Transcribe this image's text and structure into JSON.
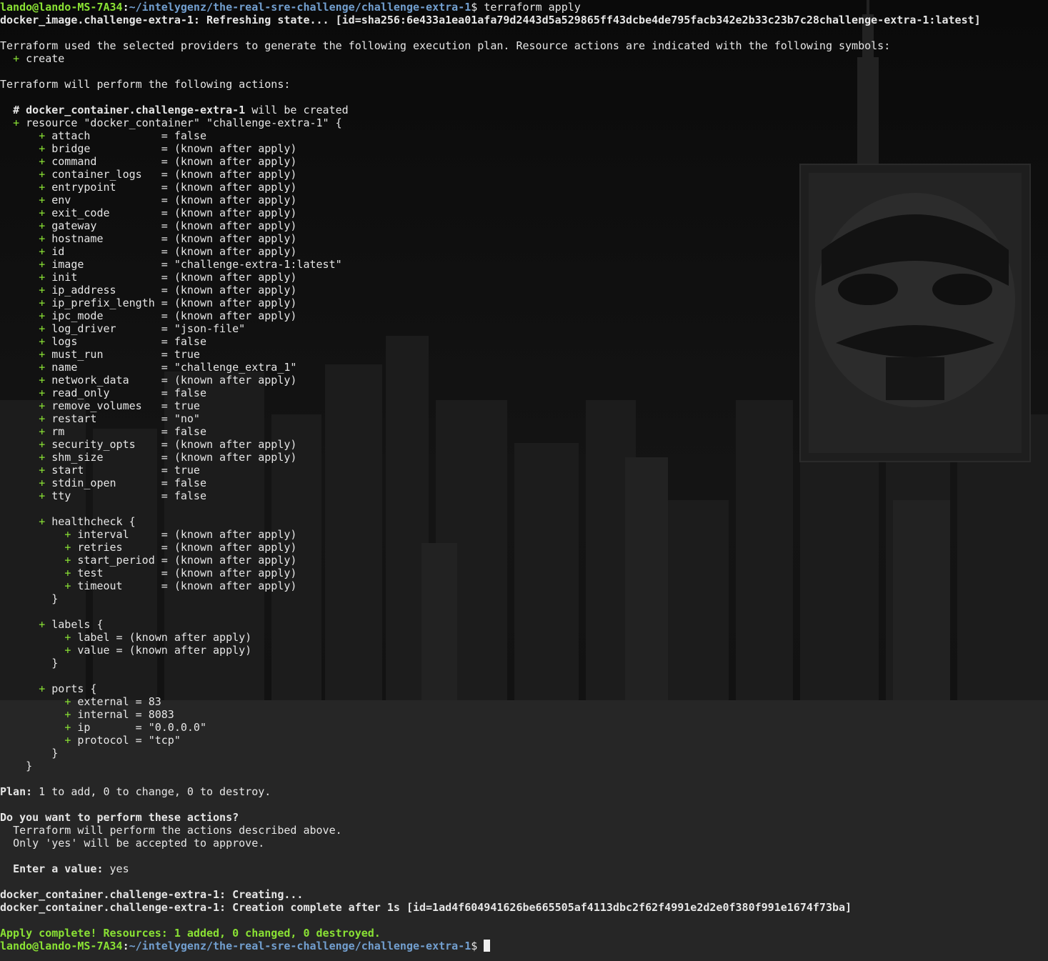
{
  "prompt": {
    "user_host": "lando@lando-MS-7A34",
    "path": "~/intelygenz/the-real-sre-challenge/challenge-extra-1",
    "symbol": "$"
  },
  "command": "terraform apply",
  "refresh_line": "docker_image.challenge-extra-1: Refreshing state... [id=sha256:6e433a1ea01afa79d2443d5a529865ff43dcbe4de795facb342e2b33c23b7c28challenge-extra-1:latest]",
  "intro": "Terraform used the selected providers to generate the following execution plan. Resource actions are indicated with the following symbols:",
  "symbol_legend": {
    "symbol": "+",
    "label": "create"
  },
  "will_perform": "Terraform will perform the following actions:",
  "resource_comment": {
    "hash": "#",
    "address": "docker_container.challenge-extra-1",
    "suffix": " will be created"
  },
  "resource_decl": "resource \"docker_container\" \"challenge-extra-1\" {",
  "attributes": [
    {
      "key": "attach",
      "value": "false"
    },
    {
      "key": "bridge",
      "value": "(known after apply)"
    },
    {
      "key": "command",
      "value": "(known after apply)"
    },
    {
      "key": "container_logs",
      "value": "(known after apply)"
    },
    {
      "key": "entrypoint",
      "value": "(known after apply)"
    },
    {
      "key": "env",
      "value": "(known after apply)"
    },
    {
      "key": "exit_code",
      "value": "(known after apply)"
    },
    {
      "key": "gateway",
      "value": "(known after apply)"
    },
    {
      "key": "hostname",
      "value": "(known after apply)"
    },
    {
      "key": "id",
      "value": "(known after apply)"
    },
    {
      "key": "image",
      "value": "\"challenge-extra-1:latest\""
    },
    {
      "key": "init",
      "value": "(known after apply)"
    },
    {
      "key": "ip_address",
      "value": "(known after apply)"
    },
    {
      "key": "ip_prefix_length",
      "value": "(known after apply)"
    },
    {
      "key": "ipc_mode",
      "value": "(known after apply)"
    },
    {
      "key": "log_driver",
      "value": "\"json-file\""
    },
    {
      "key": "logs",
      "value": "false"
    },
    {
      "key": "must_run",
      "value": "true"
    },
    {
      "key": "name",
      "value": "\"challenge_extra_1\""
    },
    {
      "key": "network_data",
      "value": "(known after apply)"
    },
    {
      "key": "read_only",
      "value": "false"
    },
    {
      "key": "remove_volumes",
      "value": "true"
    },
    {
      "key": "restart",
      "value": "\"no\""
    },
    {
      "key": "rm",
      "value": "false"
    },
    {
      "key": "security_opts",
      "value": "(known after apply)"
    },
    {
      "key": "shm_size",
      "value": "(known after apply)"
    },
    {
      "key": "start",
      "value": "true"
    },
    {
      "key": "stdin_open",
      "value": "false"
    },
    {
      "key": "tty",
      "value": "false"
    }
  ],
  "blocks": [
    {
      "name": "healthcheck",
      "items": [
        {
          "key": "interval",
          "value": "(known after apply)"
        },
        {
          "key": "retries",
          "value": "(known after apply)"
        },
        {
          "key": "start_period",
          "value": "(known after apply)"
        },
        {
          "key": "test",
          "value": "(known after apply)"
        },
        {
          "key": "timeout",
          "value": "(known after apply)"
        }
      ]
    },
    {
      "name": "labels",
      "items": [
        {
          "key": "label",
          "value": "(known after apply)"
        },
        {
          "key": "value",
          "value": "(known after apply)"
        }
      ]
    },
    {
      "name": "ports",
      "items": [
        {
          "key": "external",
          "value": "83"
        },
        {
          "key": "internal",
          "value": "8083"
        },
        {
          "key": "ip",
          "value": "\"0.0.0.0\""
        },
        {
          "key": "protocol",
          "value": "\"tcp\""
        }
      ]
    }
  ],
  "plan": {
    "label": "Plan:",
    "text": " 1 to add, 0 to change, 0 to destroy."
  },
  "question": "Do you want to perform these actions?",
  "question_lines": [
    "Terraform will perform the actions described above.",
    "Only 'yes' will be accepted to approve."
  ],
  "enter_value": {
    "label": "Enter a value:",
    "input": "yes"
  },
  "creating_line": "docker_container.challenge-extra-1: Creating...",
  "complete_line": "docker_container.challenge-extra-1: Creation complete after 1s [id=1ad4f604941626be665505af4113dbc2f62f4991e2d2e0f380f991e1674f73ba]",
  "apply_complete": "Apply complete! Resources: 1 added, 0 changed, 0 destroyed.",
  "colors": {
    "background": "#0b0b0b",
    "text": "#e6e6e6",
    "prompt_user": "#8ae234",
    "prompt_path": "#729fcf",
    "plus_sign": "#8ae234"
  }
}
